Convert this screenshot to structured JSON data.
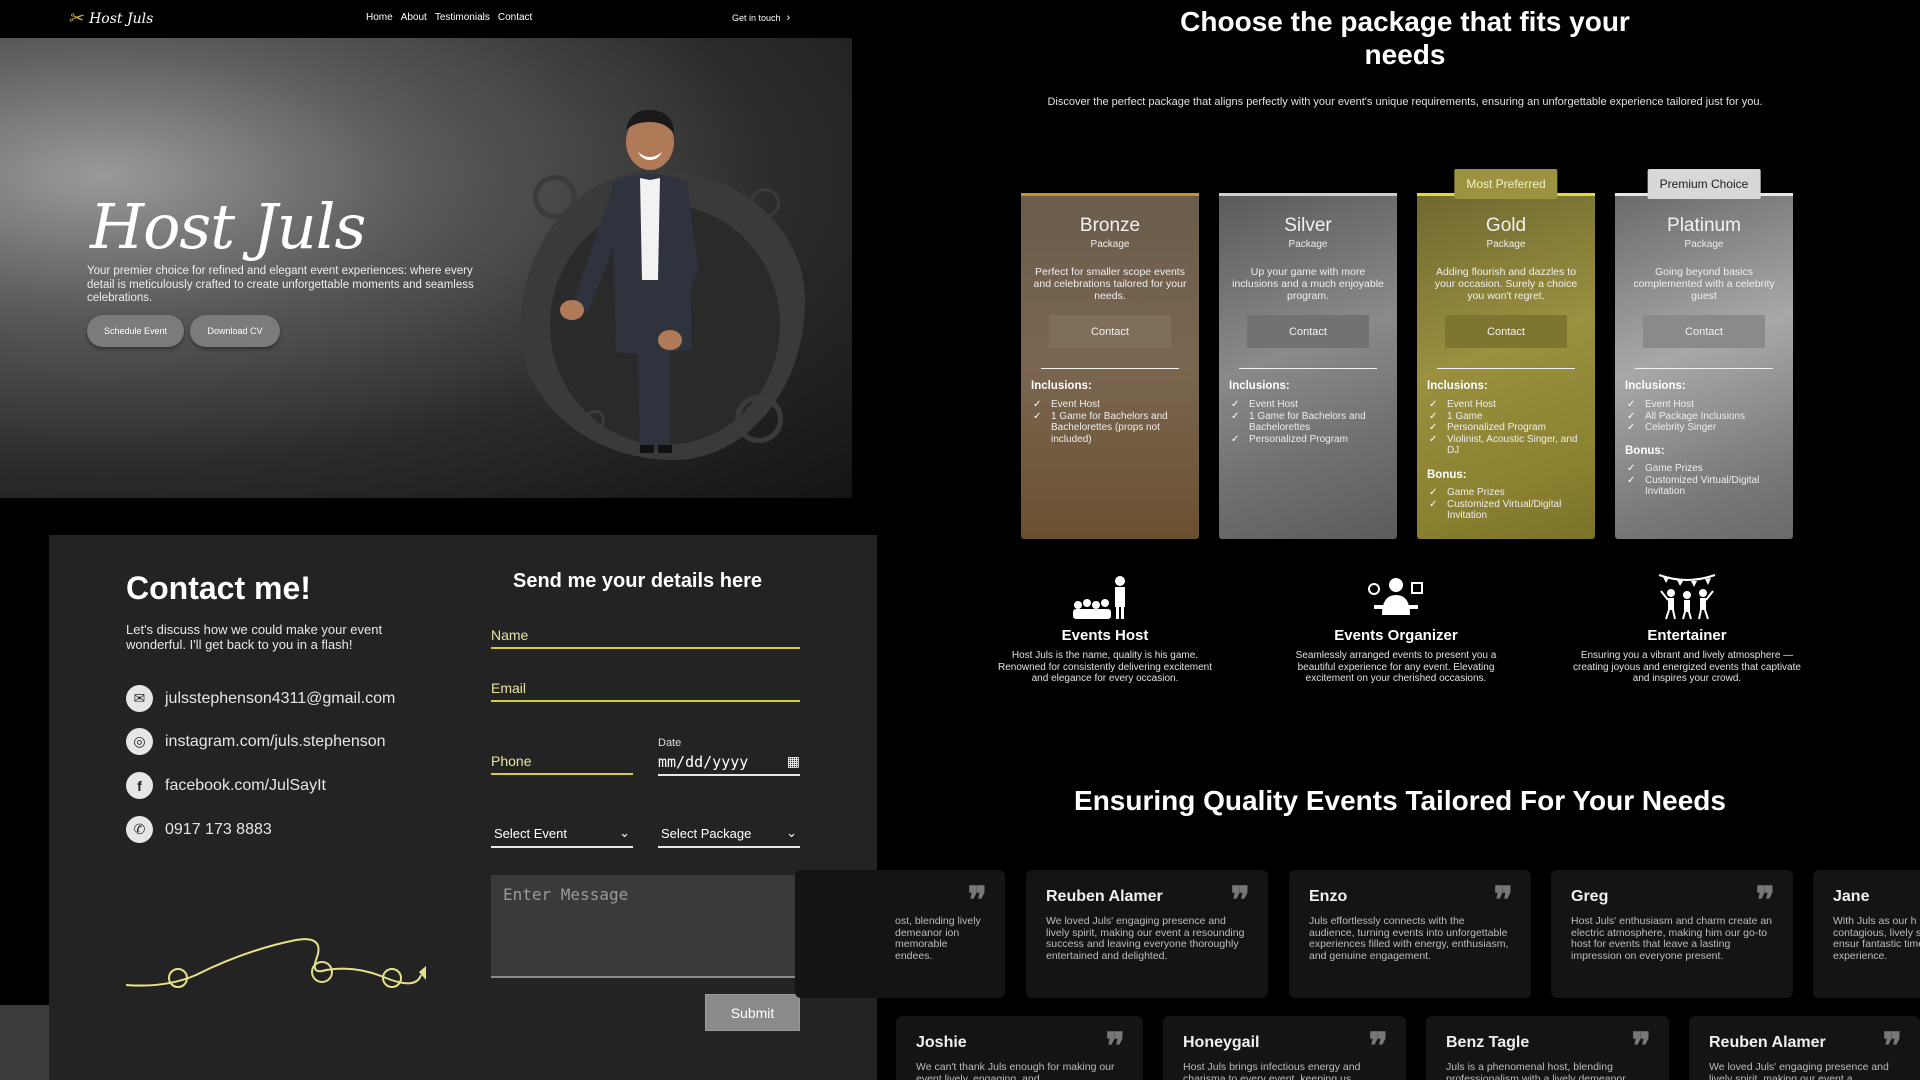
{
  "nav": {
    "logo_mark": "✂",
    "logo_text": "Host Juls",
    "links": [
      "Home",
      "About",
      "Testimonials",
      "Contact"
    ],
    "get_in_touch": "Get in touch"
  },
  "hero": {
    "title": "Host Juls",
    "subtitle": "Your premier choice for refined and elegant event experiences: where every detail is meticulously crafted to create unforgettable moments and seamless celebrations.",
    "btn_schedule": "Schedule Event",
    "btn_cv": "Download CV"
  },
  "contact": {
    "title": "Contact me!",
    "desc": "Let's discuss how we could make your event wonderful. I'll get back to you in a flash!",
    "email": "julsstephenson4311@gmail.com",
    "instagram": "instagram.com/juls.stephenson",
    "facebook": "facebook.com/JulSayIt",
    "phone": "0917 173 8883"
  },
  "form": {
    "title": "Send me your details here",
    "name_placeholder": "Name",
    "email_placeholder": "Email",
    "phone_placeholder": "Phone",
    "date_label": "Date",
    "date_value": "mm/dd/yyyy",
    "select_event": "Select Event",
    "select_package": "Select Package",
    "message_placeholder": "Enter Message",
    "submit": "Submit"
  },
  "packages": {
    "title": "Choose the package that fits your needs",
    "subtitle": "Discover the perfect package that aligns perfectly with your event's unique requirements, ensuring an unforgettable experience tailored just for you.",
    "items": [
      {
        "name": "Bronze",
        "pkg": "Package",
        "desc": "Perfect for smaller scope events and celebrations tailored for your needs.",
        "btn": "Contact",
        "incl_label": "Inclusions:",
        "inclusions": [
          "Event Host",
          "1 Game for Bachelors and Bachelorettes (props not included)"
        ],
        "accent": "#c8912e"
      },
      {
        "name": "Silver",
        "pkg": "Package",
        "desc": "Up your game with more inclusions and a much enjoyable program.",
        "btn": "Contact",
        "incl_label": "Inclusions:",
        "inclusions": [
          "Event Host",
          "1 Game for Bachelors and Bachelorettes",
          "Personalized Program"
        ],
        "accent": "#cfcfcf"
      },
      {
        "name": "Gold",
        "pkg": "Package",
        "desc": "Adding flourish and dazzles to your occasion. Surely a choice you won't regret.",
        "btn": "Contact",
        "incl_label": "Inclusions:",
        "inclusions": [
          "Event Host",
          "1 Game",
          "Personalized Program",
          "Violinist, Acoustic Singer, and DJ"
        ],
        "bonus_label": "Bonus:",
        "bonus": [
          "Game Prizes",
          "Customized Virtual/Digital Invitation"
        ],
        "badge": "Most Preferred",
        "accent": "#e6d83a"
      },
      {
        "name": "Platinum",
        "pkg": "Package",
        "desc": "Going beyond basics complemented with a celebrity guest",
        "btn": "Contact",
        "incl_label": "Inclusions:",
        "inclusions": [
          "Event Host",
          "All Package Inclusions",
          "Celebrity Singer"
        ],
        "bonus_label": "Bonus:",
        "bonus": [
          "Game Prizes",
          "Customized Virtual/Digital Invitation"
        ],
        "badge": "Premium Choice",
        "accent": "#e8e8e8"
      }
    ]
  },
  "services": [
    {
      "icon": "event-host-icon",
      "title": "Events Host",
      "desc": "Host Juls is the name, quality is his game. Renowned for consistently delivering excitement and elegance for every occasion."
    },
    {
      "icon": "event-organizer-icon",
      "title": "Events Organizer",
      "desc": "Seamlessly arranged events to present you a beautiful experience for any event. Elevating excitement on your cherished occasions."
    },
    {
      "icon": "entertainer-icon",
      "title": "Entertainer",
      "desc": "Ensuring you a vibrant and lively atmosphere — creating joyous and energized events that captivate and inspires your crowd."
    }
  ],
  "testimonials": {
    "title": "Ensuring Quality Events Tailored For Your Needs",
    "row1": [
      {
        "name": "",
        "text": "ost, blending lively demeanor ion memorable endees."
      },
      {
        "name": "Reuben Alamer",
        "text": "We loved Juls' engaging presence and lively spirit, making our event a resounding success and leaving everyone thoroughly entertained and delighted."
      },
      {
        "name": "Enzo",
        "text": "Juls effortlessly connects with the audience, turning events into unforgettable experiences filled with energy, enthusiasm, and genuine engagement."
      },
      {
        "name": "Greg",
        "text": "Host Juls' enthusiasm and charm create an electric atmosphere, making him our go-to host for events that leave a lasting impression on everyone present."
      },
      {
        "name": "Jane",
        "text": "With Juls as our h contagious, lively special and ensur fantastic time and experience."
      }
    ],
    "row2": [
      {
        "name": "Joshie",
        "text": "We can't thank Juls enough for making our event lively, engaging, and"
      },
      {
        "name": "Honeygail",
        "text": "Host Juls brings infectious energy and charisma to every event, keeping us"
      },
      {
        "name": "Benz Tagle",
        "text": "Juls is a phenomenal host, blending professionalism with a lively demeanor"
      },
      {
        "name": "Reuben Alamer",
        "text": "We loved Juls' engaging presence and lively spirit, making our event a"
      }
    ]
  }
}
